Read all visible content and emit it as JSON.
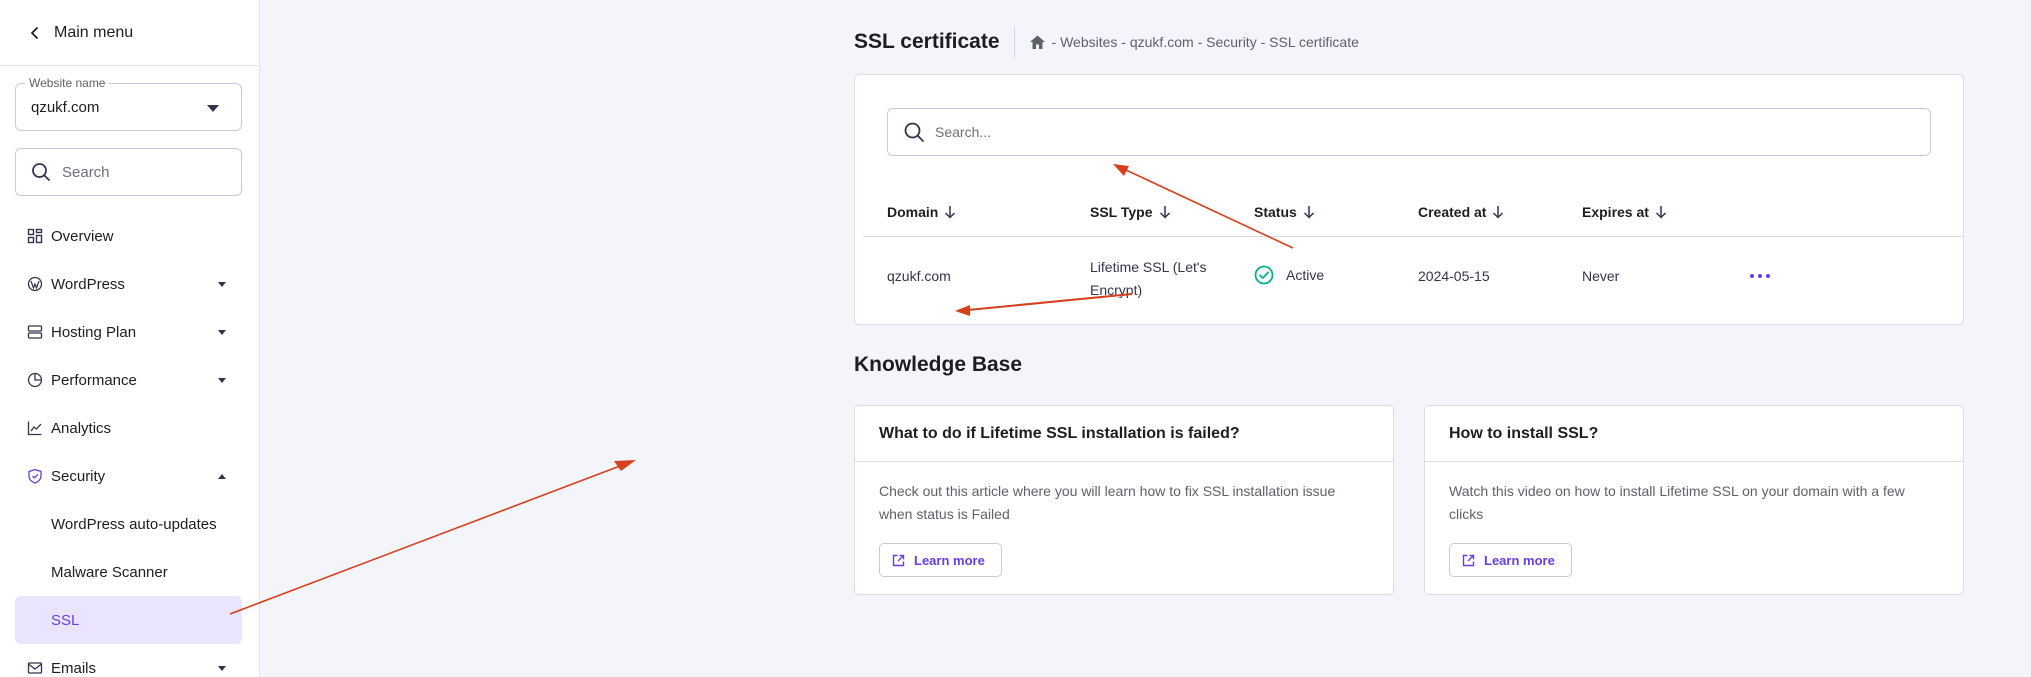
{
  "sidebar": {
    "main_menu_label": "Main menu",
    "website_select": {
      "legend": "Website name",
      "value": "qzukf.com"
    },
    "search": {
      "placeholder": "Search"
    },
    "items": [
      {
        "label": "Overview",
        "icon": "grid-icon",
        "expandable": false
      },
      {
        "label": "WordPress",
        "icon": "wordpress-icon",
        "expandable": true,
        "expanded": false
      },
      {
        "label": "Hosting Plan",
        "icon": "server-icon",
        "expandable": true,
        "expanded": false
      },
      {
        "label": "Performance",
        "icon": "pie-chart-icon",
        "expandable": true,
        "expanded": false
      },
      {
        "label": "Analytics",
        "icon": "trend-chart-icon",
        "expandable": false
      },
      {
        "label": "Security",
        "icon": "shield-check-icon",
        "expandable": true,
        "expanded": true
      },
      {
        "label": "WordPress auto-updates",
        "sub": true
      },
      {
        "label": "Malware Scanner",
        "sub": true
      },
      {
        "label": "SSL",
        "sub": true,
        "active": true
      },
      {
        "label": "Emails",
        "icon": "mail-icon",
        "expandable": true,
        "expanded": false
      }
    ]
  },
  "header": {
    "title": "SSL certificate",
    "breadcrumb": [
      "Websites",
      "qzukf.com",
      "Security",
      "SSL certificate"
    ],
    "breadcrumb_separator": "-"
  },
  "ssl_table": {
    "search_placeholder": "Search...",
    "columns": [
      "Domain",
      "SSL Type",
      "Status",
      "Created at",
      "Expires at"
    ],
    "rows": [
      {
        "domain": "qzukf.com",
        "ssl_type_line1": "Lifetime SSL (Let's",
        "ssl_type_line2": "Encrypt)",
        "status": "Active",
        "created_at": "2024-05-15",
        "expires_at": "Never"
      }
    ]
  },
  "knowledge_base": {
    "title": "Knowledge Base",
    "cards": [
      {
        "title": "What to do if Lifetime SSL installation is failed?",
        "body": "Check out this article where you will learn how to fix SSL installation issue when status is Failed",
        "button": "Learn more"
      },
      {
        "title": "How to install SSL?",
        "body": "Watch this video on how to install Lifetime SSL on your domain with a few clicks",
        "button": "Learn more"
      }
    ]
  },
  "colors": {
    "accent": "#673de6",
    "active_bg": "#ebe4ff",
    "status_ok": "#00b090",
    "annotation": "#d6401e",
    "page_bg": "#f4f4fb"
  }
}
